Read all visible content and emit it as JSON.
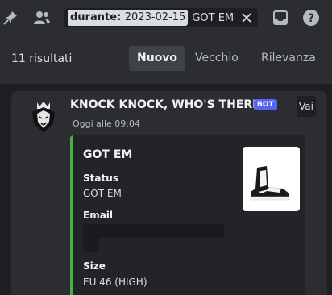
{
  "topbar": {
    "pin_icon": "pin-icon",
    "members_icon": "members-icon",
    "inbox_icon": "inbox-icon",
    "help_icon": "help-icon"
  },
  "search": {
    "filter_key": "durante:",
    "filter_value": "2023-02-15",
    "query": "GOT EM"
  },
  "results": {
    "count_label": "11 risultati",
    "tabs": [
      "Nuovo",
      "Vecchio",
      "Rilevanza"
    ],
    "active_tab": "Nuovo"
  },
  "message": {
    "author": "KNOCK KNOCK, WHO'S THERE?",
    "badge": "BOT",
    "jump_label": "Vai",
    "timestamp": "Oggi alle 09:04",
    "embed": {
      "accent_color": "#4ab23c",
      "title": "GOT EM",
      "fields": [
        {
          "name": "Status",
          "value": "GOT EM"
        },
        {
          "name": "Email",
          "value": ""
        },
        {
          "name": "Size",
          "value": "EU 46 (HIGH)"
        }
      ]
    }
  },
  "colors": {
    "background": "#1e1f22",
    "panel": "#2b2d31",
    "bot_badge": "#5865f2"
  }
}
